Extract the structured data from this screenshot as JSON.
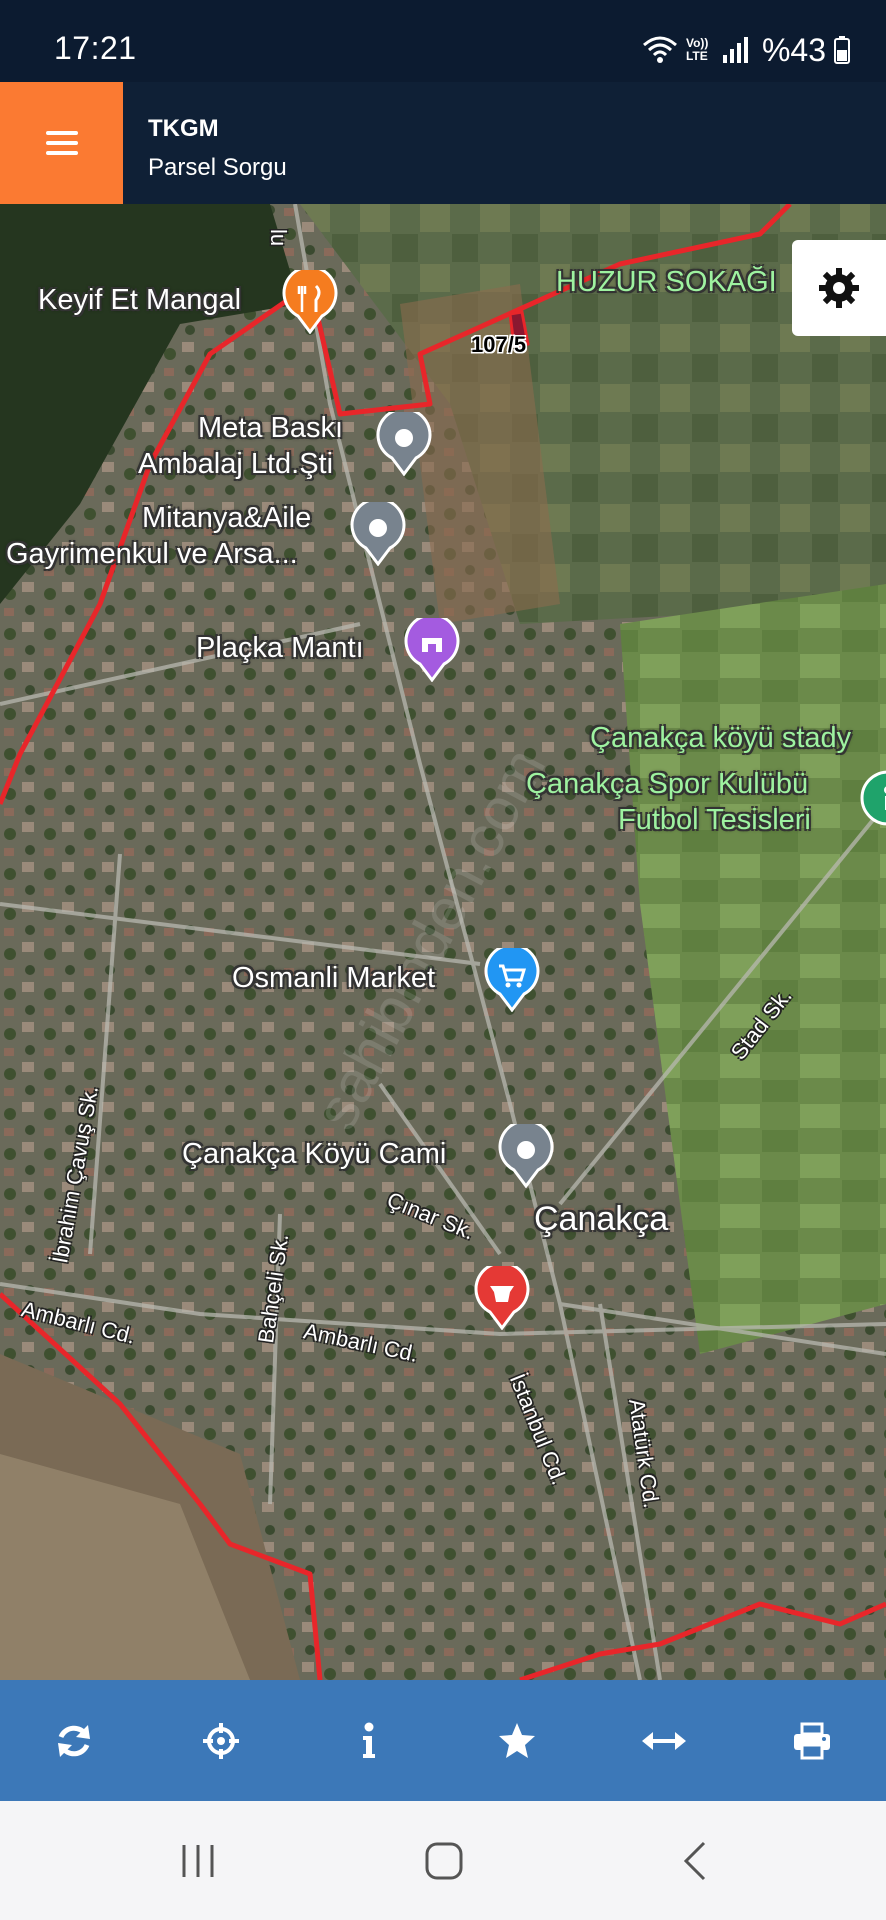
{
  "status_bar": {
    "time": "17:21",
    "battery": "%43",
    "icons": [
      "wifi-icon",
      "volte-icon",
      "signal-icon",
      "battery-icon"
    ],
    "volte_label": "Vo)) LTE"
  },
  "header": {
    "title": "TKGM",
    "subtitle": "Parsel Sorgu",
    "menu_icon": "hamburger-menu-icon",
    "accent_color": "#fb7a32",
    "background_color": "#0f2036"
  },
  "map": {
    "parcel_label": "107/5",
    "places": [
      {
        "name": "Keyif Et Mangal",
        "icon": "restaurant-icon",
        "color": "#f57c1f"
      },
      {
        "name_line1": "Meta Baskı",
        "name_line2": "Ambalaj Ltd.Şti",
        "icon": "place-icon",
        "color": "#78838e"
      },
      {
        "name_line1": "Mitanya&Aile",
        "name_line2": "Gayrimenkul ve Arsa...",
        "icon": "place-icon",
        "color": "#78838e"
      },
      {
        "name": "Plaçka Mantı",
        "icon": "shop-icon",
        "color": "#a45be0"
      },
      {
        "name": "Osmanli Market",
        "icon": "cart-icon",
        "color": "#2196f3"
      },
      {
        "name": "Çanakça Köyü Cami",
        "icon": "place-icon",
        "color": "#78838e"
      },
      {
        "name": "",
        "icon": "store-icon",
        "color": "#e53935"
      }
    ],
    "green_labels": {
      "street_top": "HUZUR SOKAĞI",
      "stadium": "Çanakça köyü stady",
      "club_line1": "Çanakça Spor Kulübü",
      "club_line2": "Futbol Tesisleri"
    },
    "village": "Çanakça",
    "streets": {
      "cinar": "Çınar Sk.",
      "ibrahim": "İbrahim Çavuş Sk.",
      "bahceli": "Bahçeli Sk.",
      "ambarli1": "Ambarlı Cd.",
      "ambarli2": "Ambarlı Cd.",
      "istanbul": "İstanbul Cd.",
      "ataturk": "Atatürk Cd.",
      "stad": "Stad Sk.",
      "top_road": "lu"
    },
    "watermark": "sahibinden.com",
    "settings_icon": "gear-icon",
    "boundary_color": "#e8262a"
  },
  "toolbar": {
    "buttons": [
      {
        "icon": "refresh-icon"
      },
      {
        "icon": "crosshair-locate-icon"
      },
      {
        "icon": "info-icon"
      },
      {
        "icon": "star-icon"
      },
      {
        "icon": "measure-arrows-icon"
      },
      {
        "icon": "print-icon"
      }
    ],
    "background_color": "#3c78b8"
  },
  "nav_bar": {
    "buttons": [
      {
        "icon": "recent-apps-icon"
      },
      {
        "icon": "home-icon"
      },
      {
        "icon": "back-icon"
      }
    ]
  }
}
